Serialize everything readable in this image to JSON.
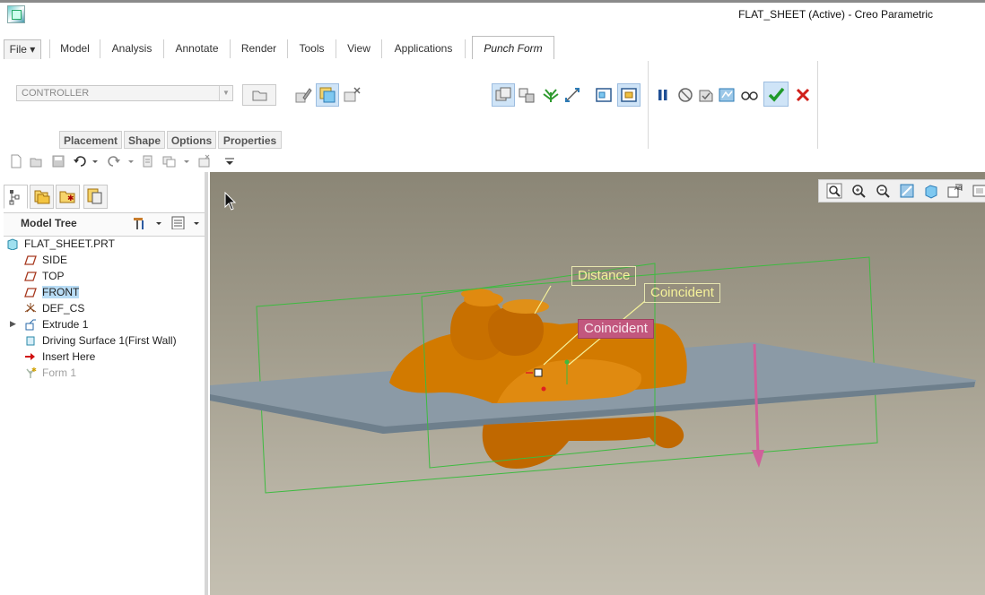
{
  "window": {
    "title": "FLAT_SHEET (Active) - Creo Parametric"
  },
  "menu_tabs": [
    {
      "label": "File ▾"
    },
    {
      "label": "Model"
    },
    {
      "label": "Analysis"
    },
    {
      "label": "Annotate"
    },
    {
      "label": "Render"
    },
    {
      "label": "Tools"
    },
    {
      "label": "View"
    },
    {
      "label": "Applications"
    },
    {
      "label": "Punch Form",
      "active": true
    }
  ],
  "ribbon": {
    "reference_select": {
      "value": "CONTROLLER"
    },
    "sub_tabs": [
      {
        "label": "Placement"
      },
      {
        "label": "Shape"
      },
      {
        "label": "Options"
      },
      {
        "label": "Properties"
      }
    ],
    "icons": [
      "folder-icon",
      "mirror-icon",
      "paste-icon",
      "remove-icon",
      "flatten-icon",
      "merge-icon",
      "green-fork-icon",
      "flip-icon",
      "view-icon",
      "preview-icon",
      "pause-icon",
      "no-icon",
      "verify-icon",
      "glasses-icon",
      "ok-icon",
      "cancel-icon"
    ]
  },
  "model_tree": {
    "title": "Model Tree",
    "items": [
      {
        "label": "FLAT_SHEET.PRT",
        "icon": "part-icon"
      },
      {
        "label": "SIDE",
        "icon": "plane-icon"
      },
      {
        "label": "TOP",
        "icon": "plane-icon"
      },
      {
        "label": "FRONT",
        "icon": "plane-icon",
        "selected": true
      },
      {
        "label": "DEF_CS",
        "icon": "csys-icon"
      },
      {
        "label": "Extrude 1",
        "icon": "extrude-icon",
        "expandable": true
      },
      {
        "label": "Driving Surface 1(First Wall)",
        "icon": "wall-icon"
      },
      {
        "label": "Insert Here",
        "icon": "insert-arrow-icon"
      },
      {
        "label": "Form 1",
        "icon": "form-icon",
        "dimmed": true
      }
    ]
  },
  "viewport": {
    "callouts": [
      {
        "label": "Distance",
        "style": "yellow"
      },
      {
        "label": "Coincident",
        "style": "yellow"
      },
      {
        "label": "Coincident",
        "style": "pink"
      }
    ]
  },
  "colors": {
    "model_orange": "#d27a00",
    "sheet_blue": "#8fa0ad",
    "datum_green": "#38c23a",
    "callout_pink": "#c2577e",
    "callout_yellow": "#f5f29a"
  }
}
